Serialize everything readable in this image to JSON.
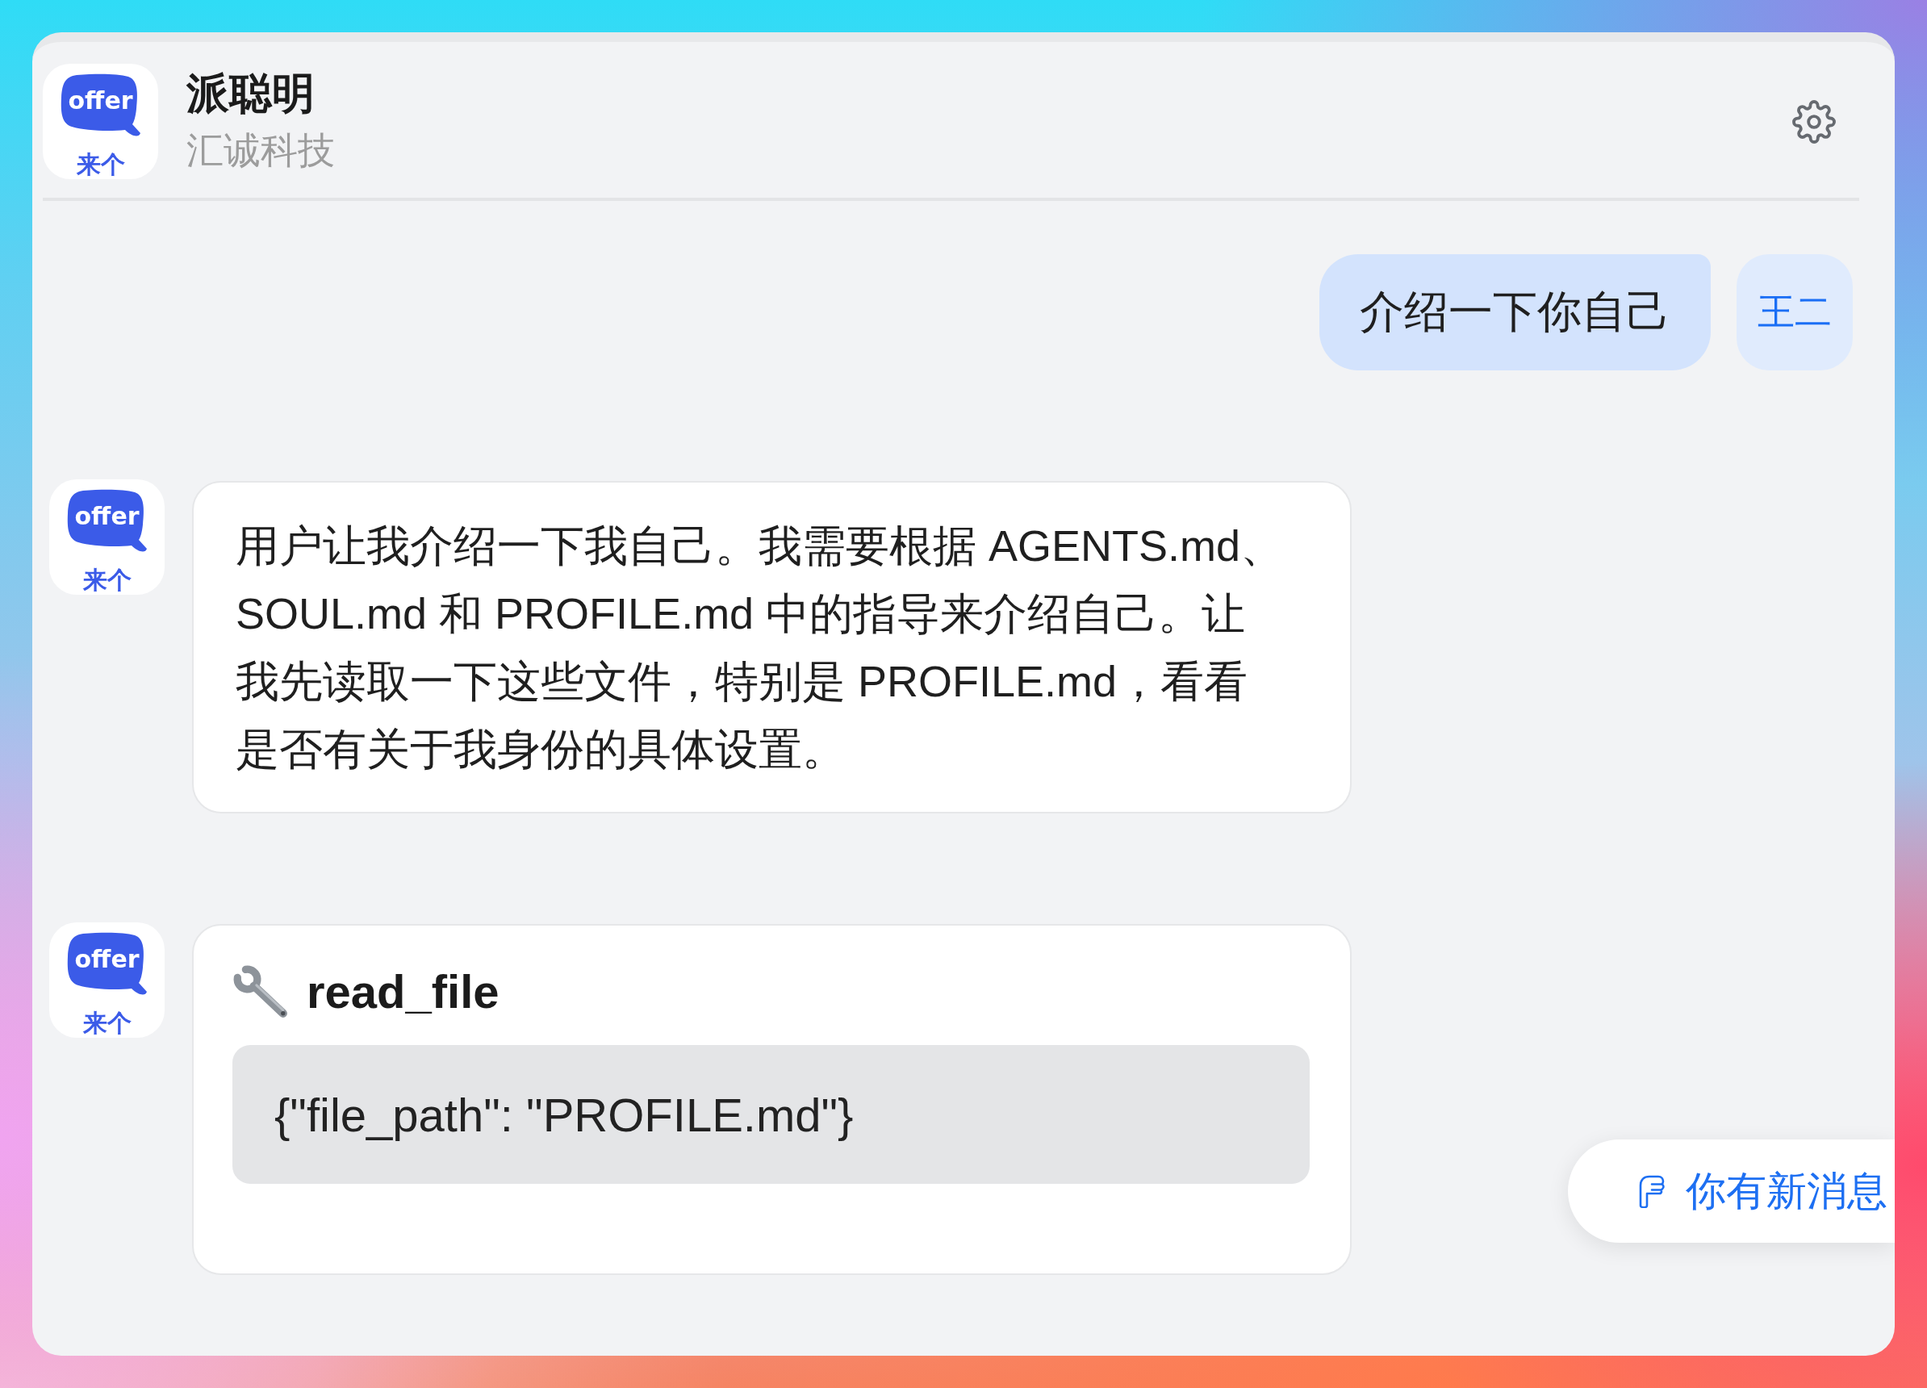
{
  "header": {
    "logo": {
      "wordmark": "offer",
      "caption": "来个"
    },
    "title": "派聪明",
    "subtitle": "汇诚科技"
  },
  "messages": [
    {
      "kind": "user_text",
      "text": "介绍一下你自己",
      "avatar": "王二"
    },
    {
      "kind": "assistant_text",
      "logo": {
        "wordmark": "offer",
        "caption": "来个"
      },
      "text": "用户让我介绍一下我自己。我需要根据 AGENTS.md、SOUL.md 和 PROFILE.md 中的指导来介绍自己。让我先读取一下这些文件，特别是 PROFILE.md，看看是否有关于我身份的具体设置。"
    },
    {
      "kind": "tool_call",
      "logo": {
        "wordmark": "offer",
        "caption": "来个"
      },
      "tool_name": "read_file",
      "arguments": "{\"file_path\": \"PROFILE.md\"}"
    }
  ],
  "new_message_notice": {
    "label": "你有新消息"
  }
}
